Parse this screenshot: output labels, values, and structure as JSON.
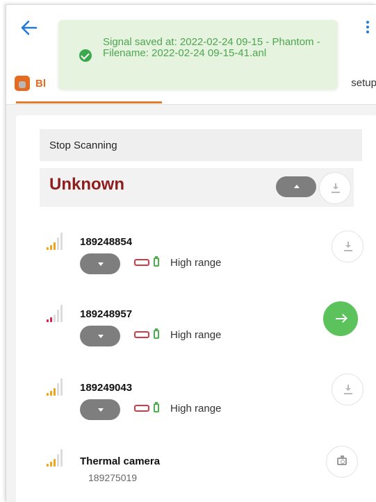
{
  "toast": {
    "message": "Signal saved at: 2022-02-24 09-15 - Phantom - Filename: 2022-02-24 09-15-41.anl",
    "color": "#4ba64f"
  },
  "tabs": {
    "ble_label": "Bl",
    "setup_label": "setup"
  },
  "scan": {
    "stop_label": "Stop Scanning"
  },
  "group": {
    "title": "Unknown",
    "title_color": "#8e1d1d"
  },
  "sensors": [
    {
      "id": "189248854",
      "range": "High range",
      "signal_color": "#f0a41a",
      "action": "download-icon"
    },
    {
      "id": "189248957",
      "range": "High range",
      "signal_color": "#d6224f",
      "action": "arrow-right-icon"
    },
    {
      "id": "189249043",
      "range": "High range",
      "signal_color": "#f0a41a",
      "action": "download-icon"
    }
  ],
  "camera": {
    "title": "Thermal camera",
    "id": "189275019",
    "signal_color": "#f0a41a",
    "action": "camera-icon"
  },
  "colors": {
    "accent": "#e87a2e",
    "action_green": "#5cc25c",
    "battery": "#d23a4a",
    "plug": "#4cb04c"
  }
}
